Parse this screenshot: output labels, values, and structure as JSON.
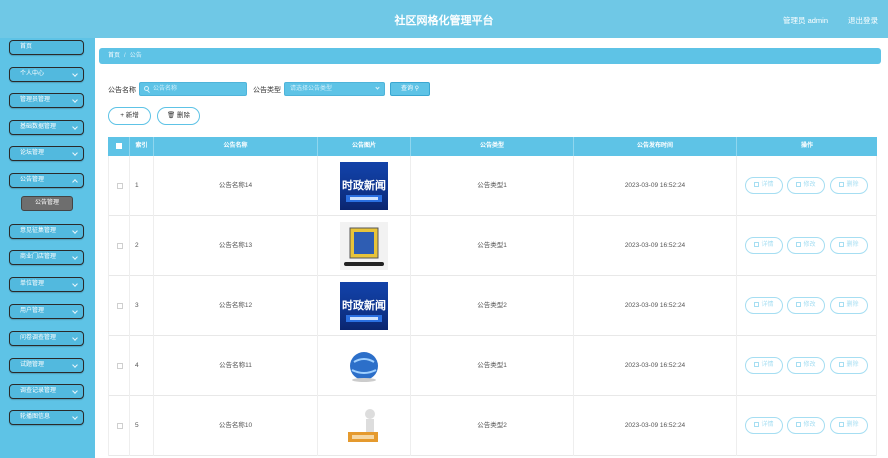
{
  "header": {
    "title": "社区网格化管理平台",
    "user_label": "管理员 admin",
    "logout_label": "退出登录"
  },
  "sidebar": {
    "items": [
      {
        "label": "首页",
        "has_arrow": false
      },
      {
        "label": "个人中心",
        "has_arrow": true
      },
      {
        "label": "管理员管理",
        "has_arrow": true
      },
      {
        "label": "基础数据管理",
        "has_arrow": true
      },
      {
        "label": "论坛管理",
        "has_arrow": true
      },
      {
        "label": "公告管理",
        "has_arrow": true,
        "open": true
      },
      {
        "label": "意见征集管理",
        "has_arrow": true
      },
      {
        "label": "商业门店管理",
        "has_arrow": true
      },
      {
        "label": "单位管理",
        "has_arrow": true
      },
      {
        "label": "用户管理",
        "has_arrow": true
      },
      {
        "label": "问卷调查管理",
        "has_arrow": true
      },
      {
        "label": "试题管理",
        "has_arrow": true
      },
      {
        "label": "调查记录管理",
        "has_arrow": true
      },
      {
        "label": "轮播图信息",
        "has_arrow": true
      }
    ],
    "submenu_active": "公告管理"
  },
  "breadcrumb": {
    "home": "首页",
    "separator": "/",
    "current": "公告"
  },
  "search": {
    "name_label": "公告名称",
    "name_placeholder": "公告名称",
    "type_label": "公告类型",
    "type_placeholder": "请选择公告类型",
    "query_label": "查询"
  },
  "actions": {
    "add_label": "新增",
    "delete_label": "删除"
  },
  "table": {
    "columns": [
      "索引",
      "公告名称",
      "公告图片",
      "公告类型",
      "公告发布时间",
      "操作"
    ],
    "row_buttons": {
      "detail": "详情",
      "edit": "修改",
      "delete": "删除"
    },
    "rows": [
      {
        "index": "1",
        "name": "公告名称14",
        "image": "时政新闻",
        "type": "公告类型1",
        "time": "2023-03-09 16:52:24"
      },
      {
        "index": "2",
        "name": "公告名称13",
        "image": "",
        "type": "公告类型1",
        "time": "2023-03-09 16:52:24"
      },
      {
        "index": "3",
        "name": "公告名称12",
        "image": "时政新闻",
        "type": "公告类型2",
        "time": "2023-03-09 16:52:24"
      },
      {
        "index": "4",
        "name": "公告名称11",
        "image": "",
        "type": "公告类型1",
        "time": "2023-03-09 16:52:24"
      },
      {
        "index": "5",
        "name": "公告名称10",
        "image": "",
        "type": "公告类型2",
        "time": "2023-03-09 16:52:24"
      }
    ]
  },
  "colors": {
    "accent": "#5ec3e6",
    "header": "#6fc8e6",
    "submenu_active_bg": "#6e6e6e"
  }
}
